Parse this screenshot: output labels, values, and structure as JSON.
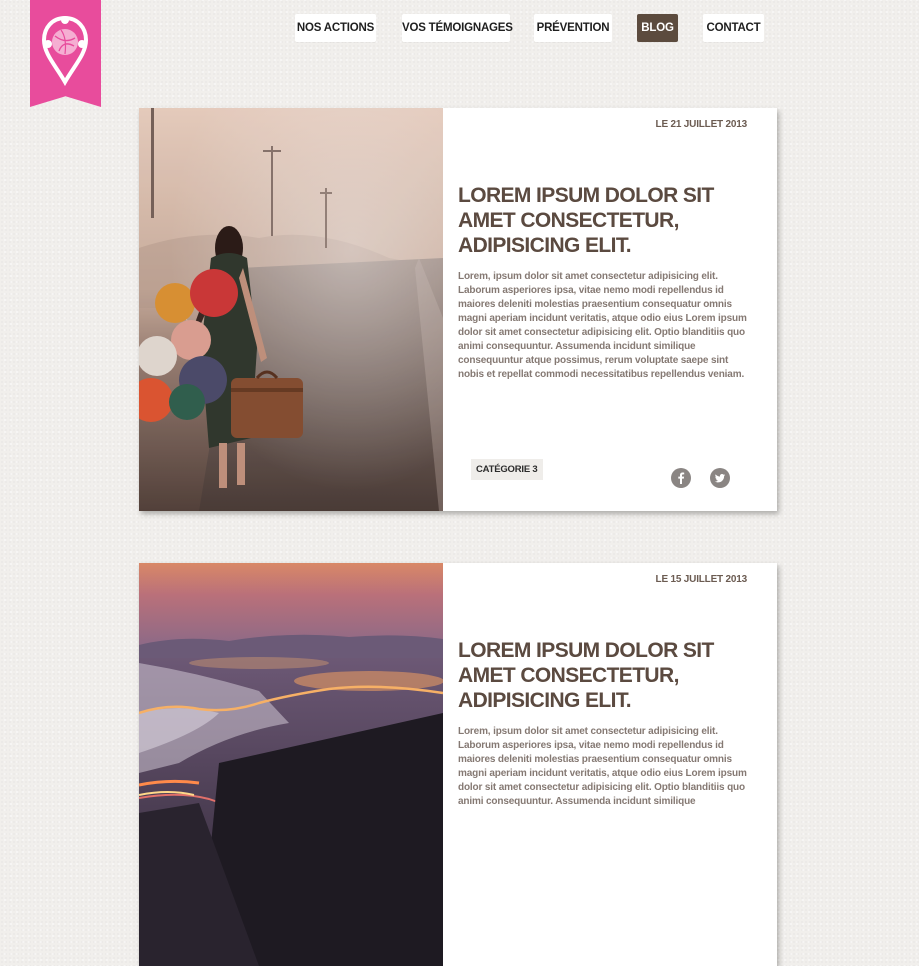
{
  "nav": {
    "items": [
      {
        "label": "NOS ACTIONS"
      },
      {
        "label": "VOS TÉMOIGNAGES"
      },
      {
        "label": "PRÉVENTION"
      },
      {
        "label": "BLOG"
      },
      {
        "label": "CONTACT"
      }
    ],
    "active": "BLOG"
  },
  "posts": [
    {
      "date": "LE 21 JUILLET 2013",
      "title": "LOREM IPSUM DOLOR SIT AMET CONSECTETUR, ADIPISICING ELIT.",
      "excerpt": "Lorem, ipsum dolor sit amet consectetur adipisicing elit. Laborum asperiores ipsa, vitae nemo modi repellendus id maiores deleniti molestias praesentium consequatur omnis magni aperiam incidunt veritatis, atque odio eius Lorem ipsum dolor sit amet consectetur adipisicing elit. Optio blanditiis quo animi consequuntur. Assumenda incidunt similique consequuntur atque possimus, rerum voluptate saepe sint nobis et repellat commodi necessitatibus repellendus veniam.",
      "category": "CATÉGORIE 3",
      "image": "woman-with-balloons-and-suitcase-on-misty-road"
    },
    {
      "date": "LE 15 JUILLET 2013",
      "title": "LOREM IPSUM DOLOR SIT AMET CONSECTETUR, ADIPISICING ELIT.",
      "excerpt": "Lorem, ipsum dolor sit amet consectetur adipisicing elit. Laborum asperiores ipsa, vitae nemo modi repellendus id maiores deleniti molestias praesentium consequatur omnis magni aperiam incidunt veritatis, atque odio eius Lorem ipsum dolor sit amet consectetur adipisicing elit. Optio blanditiis quo animi consequuntur. Assumenda incidunt similique",
      "image": "snowy-valley-road-light-trails-at-dusk"
    }
  ],
  "colors": {
    "brand_pink": "#e84c9c",
    "active_nav": "#5c4b3e",
    "title_brown": "#5b4a40",
    "body_text": "#857973",
    "page_bg": "#f1efec"
  },
  "icons": [
    "map-pin-logo-icon",
    "facebook-icon",
    "twitter-icon"
  ]
}
